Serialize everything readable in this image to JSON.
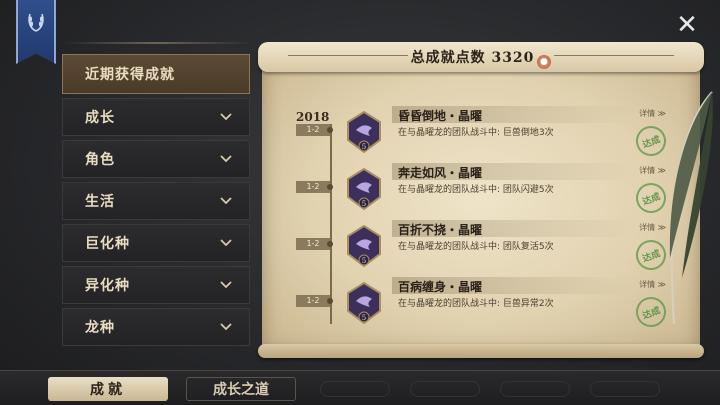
{
  "sidebar": {
    "items": [
      {
        "label": "近期获得成就"
      },
      {
        "label": "成长"
      },
      {
        "label": "角色"
      },
      {
        "label": "生活"
      },
      {
        "label": "巨化种"
      },
      {
        "label": "异化种"
      },
      {
        "label": "龙种"
      }
    ]
  },
  "scroll": {
    "points_label": "总成就点数 3320",
    "year": "2018",
    "entries": [
      {
        "date": "1-2",
        "title": "昏昏倒地・晶曜",
        "desc": "在与晶曜龙的团队战斗中: 巨兽倒地3次",
        "detail": "详情",
        "stamp": "达成",
        "badge_num": "5"
      },
      {
        "date": "1-2",
        "title": "奔走如风・晶曜",
        "desc": "在与晶曜龙的团队战斗中: 团队闪避5次",
        "detail": "详情",
        "stamp": "达成",
        "badge_num": "5"
      },
      {
        "date": "1-2",
        "title": "百折不挠・晶曜",
        "desc": "在与晶曜龙的团队战斗中: 团队复活5次",
        "detail": "详情",
        "stamp": "达成",
        "badge_num": "5"
      },
      {
        "date": "1-2",
        "title": "百病缠身・晶曜",
        "desc": "在与晶曜龙的团队战斗中: 巨兽异常2次",
        "detail": "详情",
        "stamp": "达成",
        "badge_num": "5"
      }
    ]
  },
  "tabs": {
    "achievement": "成就",
    "growth": "成长之道"
  },
  "icons": {
    "close": "close-icon",
    "banner": "laurel-banner-icon",
    "chevron": "chevron-down-icon",
    "badge": "achievement-badge-icon",
    "feather": "quill-feather-icon"
  }
}
